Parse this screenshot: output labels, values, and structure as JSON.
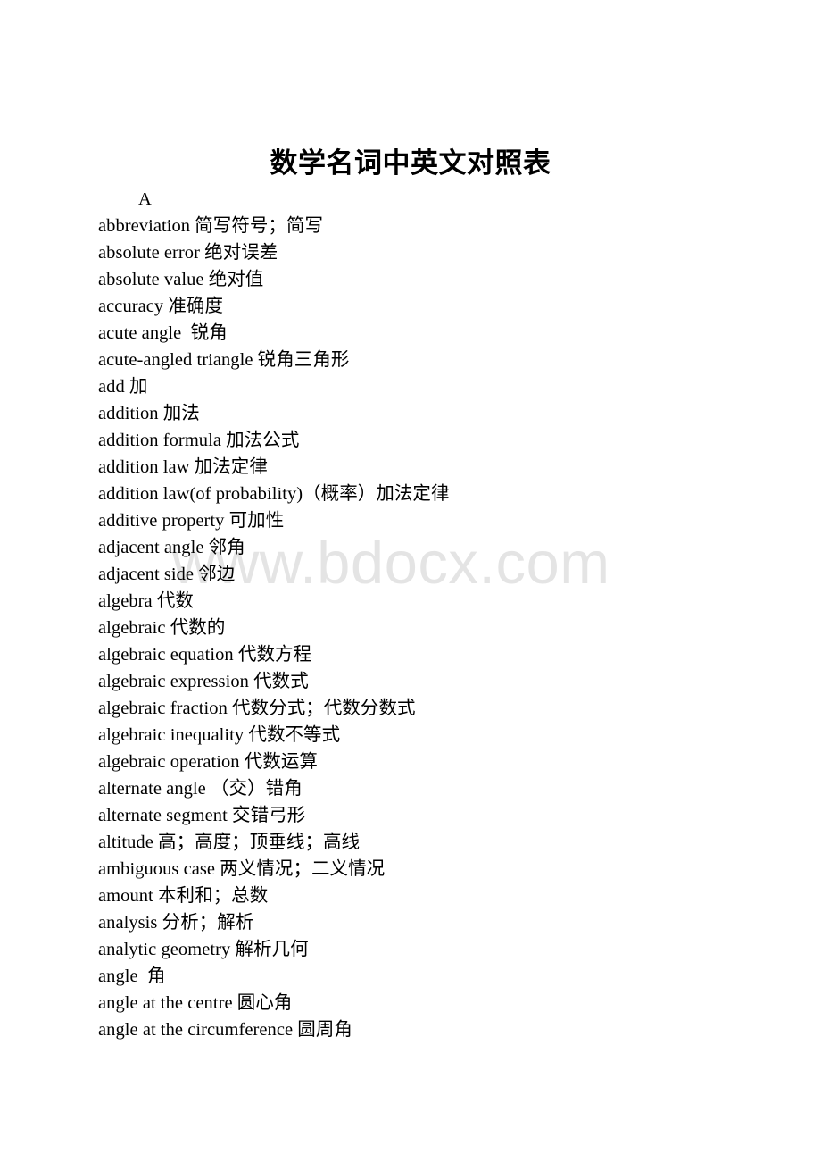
{
  "document": {
    "title": "数学名词中英文对照表",
    "background_color": "#ffffff",
    "text_color": "#000000"
  },
  "watermark": {
    "text": "www.bdocx.com",
    "color": "#e4e4e4"
  },
  "glossary": {
    "section_letter": "A",
    "entries": [
      "A",
      "abbreviation 简写符号；简写",
      "absolute error 绝对误差",
      "absolute value 绝对值",
      "accuracy 准确度",
      "acute angle  锐角",
      "acute-angled triangle 锐角三角形",
      "add 加",
      "addition 加法",
      "addition formula 加法公式",
      "addition law 加法定律",
      "addition law(of probability)（概率）加法定律",
      "additive property 可加性",
      "adjacent angle 邻角",
      "adjacent side 邻边",
      "algebra 代数",
      "algebraic 代数的",
      "algebraic equation 代数方程",
      "algebraic expression 代数式",
      "algebraic fraction 代数分式；代数分数式",
      "algebraic inequality 代数不等式",
      "algebraic operation 代数运算",
      "alternate angle （交）错角",
      "alternate segment 交错弓形",
      "altitude 高；高度；顶垂线；高线",
      "ambiguous case 两义情况；二义情况",
      "amount 本利和；总数",
      "analysis 分析；解析",
      "analytic geometry 解析几何",
      "angle  角",
      "angle at the centre 圆心角",
      "angle at the circumference 圆周角"
    ]
  }
}
